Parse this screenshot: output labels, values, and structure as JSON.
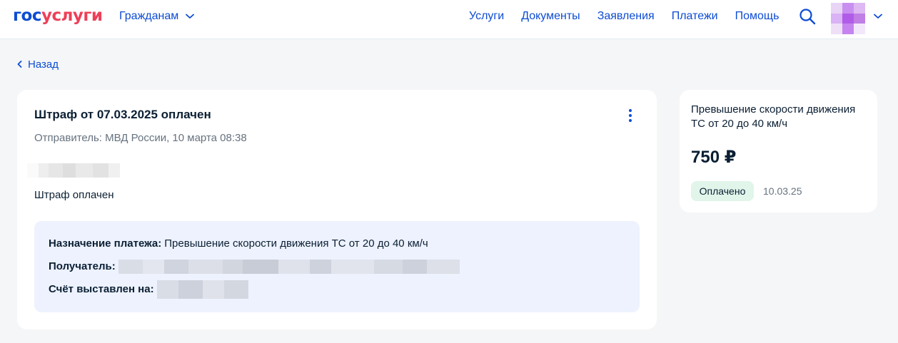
{
  "header": {
    "logo_part1": "гос",
    "logo_part2": "услуги",
    "audience": "Гражданам",
    "nav": [
      "Услуги",
      "Документы",
      "Заявления",
      "Платежи",
      "Помощь"
    ]
  },
  "back_label": "Назад",
  "fine": {
    "title": "Штраф от 07.03.2025 оплачен",
    "sender": "Отправитель: МВД России, 10 марта 08:38",
    "status_text": "Штраф оплачен",
    "purpose_label": "Назначение платежа:",
    "purpose_value": "Превышение скорости движения ТС от 20 до 40 км/ч",
    "recipient_label": "Получатель:",
    "issued_label": "Счёт выставлен на:"
  },
  "summary": {
    "title": "Превышение скорости движения ТС от 20 до 40 км/ч",
    "amount": "750 ₽",
    "status_badge": "Оплачено",
    "date": "10.03.25"
  },
  "colors": {
    "brand_blue": "#0d4cd3",
    "brand_red": "#ee3f58",
    "info_bg": "#edf2fe",
    "paid_badge_bg": "#e1f5ea"
  }
}
